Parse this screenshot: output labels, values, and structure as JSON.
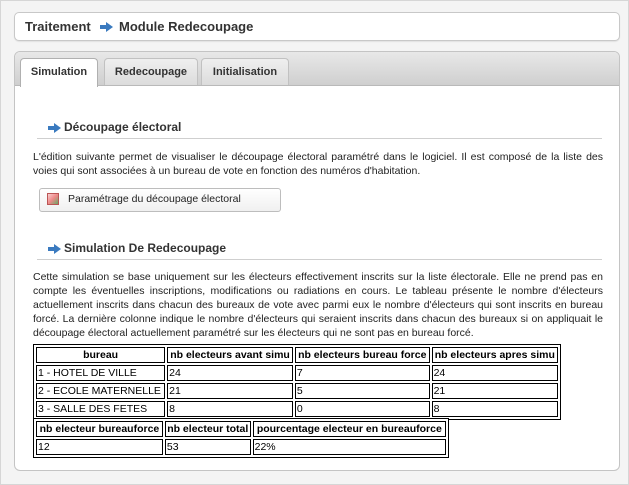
{
  "breadcrumb": {
    "part1": "Traitement",
    "part2": "Module Redecoupage"
  },
  "tabs": [
    {
      "label": "Simulation",
      "active": true
    },
    {
      "label": "Redecoupage",
      "active": false
    },
    {
      "label": "Initialisation",
      "active": false
    }
  ],
  "section1": {
    "title": "Découpage électoral",
    "text": "L'édition suivante permet de visualiser le découpage électoral paramétré dans le logiciel. Il est composé de la liste des voies qui sont associées à un bureau de vote en fonction des numéros d'habitation.",
    "button_label": "Paramétrage du découpage électoral"
  },
  "section2": {
    "title": "Simulation De Redecoupage",
    "text": "Cette simulation se base uniquement sur les électeurs effectivement inscrits sur la liste électorale. Elle ne prend pas en compte les éventuelles inscriptions, modifications ou radiations en cours. Le tableau présente le nombre d'électeurs actuellement inscrits dans chacun des bureaux de vote avec parmi eux le nombre d'électeurs qui sont inscrits en bureau forcé. La dernière colonne indique le nombre d'électeurs qui seraient inscrits dans chacun des bureaux si on appliquait le découpage électoral actuellement paramétré sur les électeurs qui ne sont pas en bureau forcé."
  },
  "table1": {
    "headers": [
      "bureau",
      "nb electeurs avant simu",
      "nb electeurs bureau force",
      "nb electeurs apres simu"
    ],
    "rows": [
      [
        "1 - HOTEL DE VILLE",
        "24",
        "7",
        "24"
      ],
      [
        "2 - ECOLE MATERNELLE",
        "21",
        "5",
        "21"
      ],
      [
        "3 - SALLE DES FETES",
        "8",
        "0",
        "8"
      ]
    ]
  },
  "table2": {
    "headers": [
      "nb electeur bureauforce",
      "nb electeur total",
      "pourcentage electeur en bureauforce"
    ],
    "rows": [
      [
        "12",
        "53",
        "22%"
      ]
    ]
  },
  "colors": {
    "accent": "#3a7abf"
  }
}
